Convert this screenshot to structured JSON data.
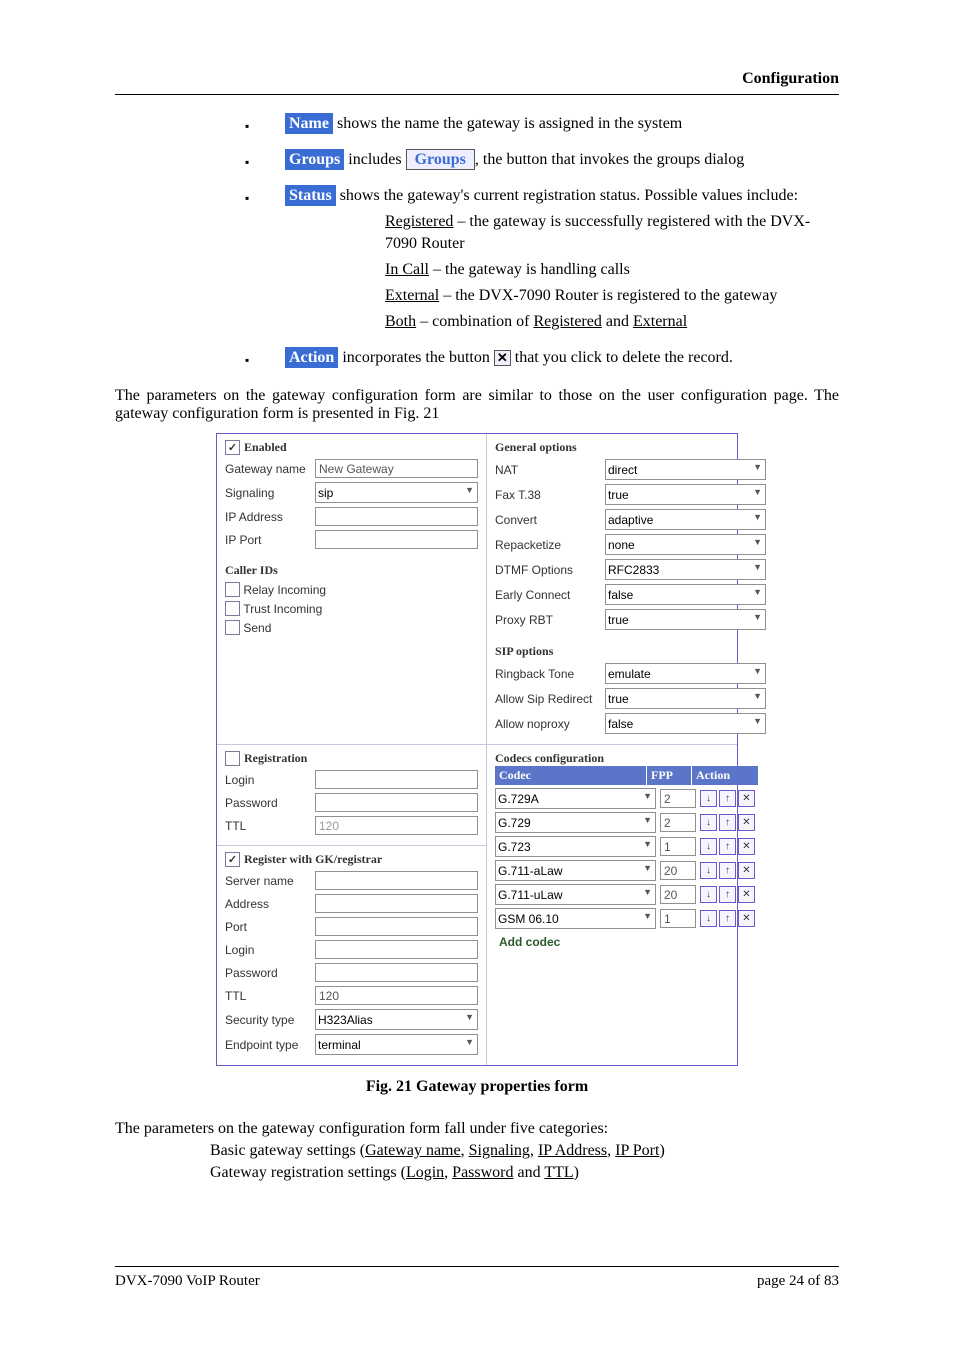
{
  "header": {
    "section": "Configuration"
  },
  "bullets": {
    "name": {
      "tag": "Name",
      "text": " shows the  name the gateway is assigned in the system"
    },
    "groups": {
      "tag": "Groups",
      "before": " includes ",
      "button": "Groups",
      "after": ", the button that invokes the groups dialog"
    },
    "status": {
      "tag": "Status",
      "text": " shows the gateway's current registration status. Possible values include:"
    },
    "status_items": [
      {
        "k": "Registered",
        "v": " – the gateway is successfully registered with the DVX-7090 Router"
      },
      {
        "k": "In Call",
        "v": " – the gateway is handling calls"
      },
      {
        "k": "External",
        "v": " – the DVX-7090 Router is registered to the gateway"
      }
    ],
    "status_both": {
      "k": "Both",
      "mid": " – combination of ",
      "a": "Registered",
      "and": " and ",
      "b": "External"
    },
    "action": {
      "tag": "Action",
      "before": " incorporates the button ",
      "icon": "✕",
      "after": " that you click to delete the record."
    }
  },
  "para1": "The parameters on the gateway configuration form are similar to those on the user configuration page. The gateway configuration form is presented in Fig. 21",
  "form": {
    "enabled": {
      "checked": true,
      "label": "Enabled"
    },
    "basic": {
      "gateway_name": {
        "label": "Gateway name",
        "value": "New Gateway"
      },
      "signaling": {
        "label": "Signaling",
        "value": "sip"
      },
      "ip_address": {
        "label": "IP Address",
        "value": ""
      },
      "ip_port": {
        "label": "IP Port",
        "value": ""
      }
    },
    "caller_ids": {
      "title": "Caller IDs",
      "relay": "Relay Incoming",
      "trust": "Trust Incoming",
      "send": "Send"
    },
    "general": {
      "title": "General options",
      "nat": {
        "label": "NAT",
        "value": "direct"
      },
      "fax": {
        "label": "Fax T.38",
        "value": "true"
      },
      "convert": {
        "label": "Convert",
        "value": "adaptive"
      },
      "repack": {
        "label": "Repacketize",
        "value": "none"
      },
      "dtmf": {
        "label": "DTMF Options",
        "value": "RFC2833"
      },
      "early": {
        "label": "Early Connect",
        "value": "false"
      },
      "proxy": {
        "label": "Proxy RBT",
        "value": "true"
      }
    },
    "sip": {
      "title": "SIP options",
      "ring": {
        "label": "Ringback Tone",
        "value": "emulate"
      },
      "redir": {
        "label": "Allow Sip Redirect",
        "value": "true"
      },
      "noproxy": {
        "label": "Allow noproxy",
        "value": "false"
      }
    },
    "registration": {
      "title": "Registration",
      "checked": false,
      "login": {
        "label": "Login",
        "value": ""
      },
      "password": {
        "label": "Password",
        "value": ""
      },
      "ttl": {
        "label": "TTL",
        "value": "120"
      }
    },
    "gk": {
      "title": "Register with GK/registrar",
      "checked": true,
      "server": {
        "label": "Server name",
        "value": ""
      },
      "address": {
        "label": "Address",
        "value": ""
      },
      "port": {
        "label": "Port",
        "value": ""
      },
      "login": {
        "label": "Login",
        "value": ""
      },
      "password": {
        "label": "Password",
        "value": ""
      },
      "ttl": {
        "label": "TTL",
        "value": "120"
      },
      "security": {
        "label": "Security type",
        "value": "H323Alias"
      },
      "endpoint": {
        "label": "Endpoint type",
        "value": "terminal"
      }
    },
    "codecs": {
      "title": "Codecs configuration",
      "h_codec": "Codec",
      "h_fpp": "FPP",
      "h_action": "Action",
      "rows": [
        {
          "name": "G.729A",
          "fpp": "2"
        },
        {
          "name": "G.729",
          "fpp": "2"
        },
        {
          "name": "G.723",
          "fpp": "1"
        },
        {
          "name": "G.711-aLaw",
          "fpp": "20"
        },
        {
          "name": "G.711-uLaw",
          "fpp": "20"
        },
        {
          "name": "GSM 06.10",
          "fpp": "1"
        }
      ],
      "add": "Add codec"
    }
  },
  "caption": "Fig. 21 Gateway properties form",
  "para2": "The parameters on the gateway configuration form fall under five categories:",
  "cat1": {
    "pre": "Basic gateway settings (",
    "a": "Gateway name",
    "s1": ", ",
    "b": "Signaling",
    "s2": ", ",
    "c": "IP Address",
    "s3": ", ",
    "d": "IP Port",
    "post": ")"
  },
  "cat2": {
    "pre": "Gateway registration settings (",
    "a": "Login",
    "s1": ", ",
    "b": "Password",
    "s2": " and ",
    "c": "TTL",
    "post": ")"
  },
  "footer": {
    "left": "DVX-7090 VoIP Router",
    "right": "page 24 of 83"
  }
}
